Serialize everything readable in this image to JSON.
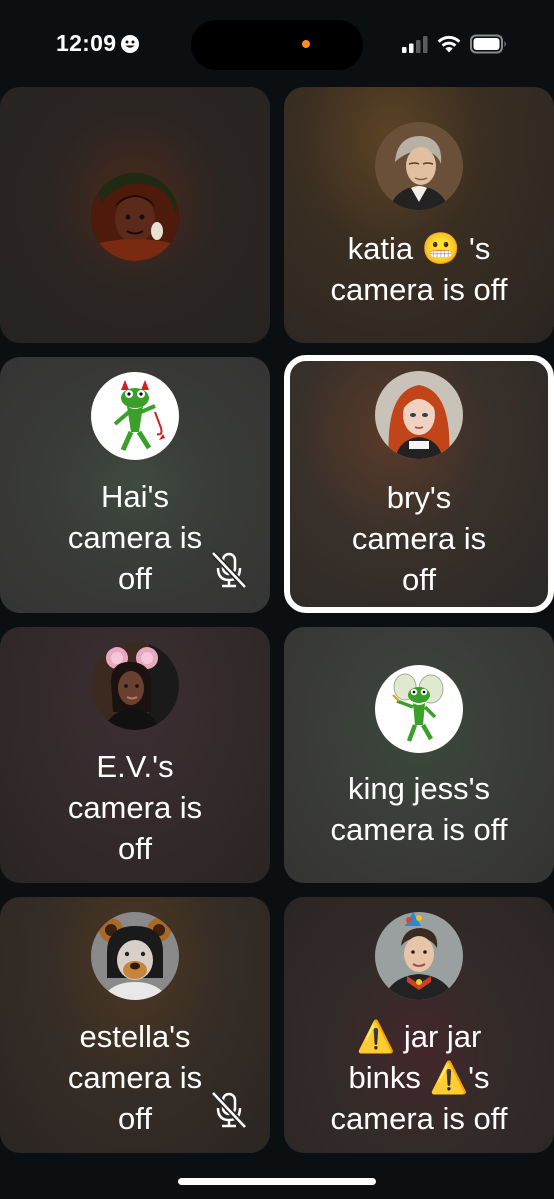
{
  "status_bar": {
    "time": "12:09",
    "focus_icon": "smiley-focus-icon",
    "privacy_dot_color": "#ff8a1f",
    "icons": [
      "cellular-signal-icon",
      "wifi-icon",
      "battery-icon"
    ]
  },
  "tiles": [
    {
      "name": "",
      "lines": [],
      "muted": false,
      "selected": false,
      "avatar": "avatar-dark-cartoon"
    },
    {
      "name": "katia 😬",
      "lines": [
        "katia 😬 's",
        "camera is off"
      ],
      "muted": false,
      "selected": false,
      "avatar": "avatar-portrait-painting"
    },
    {
      "name": "Hai",
      "lines": [
        "Hai's",
        "camera is",
        "off"
      ],
      "muted": true,
      "selected": false,
      "avatar": "avatar-devil-frog"
    },
    {
      "name": "bry",
      "lines": [
        "bry's",
        "camera is",
        "off"
      ],
      "muted": false,
      "selected": true,
      "avatar": "avatar-red-hair"
    },
    {
      "name": "E.V.",
      "lines": [
        "E.V.'s",
        "camera is",
        "off"
      ],
      "muted": false,
      "selected": false,
      "avatar": "avatar-mouse-ears"
    },
    {
      "name": "king jess",
      "lines": [
        "king jess's",
        "camera is off"
      ],
      "muted": false,
      "selected": false,
      "avatar": "avatar-fairy-frog"
    },
    {
      "name": "estella",
      "lines": [
        "estella's",
        "camera is",
        "off"
      ],
      "muted": true,
      "selected": false,
      "avatar": "avatar-bear-filter"
    },
    {
      "name": "⚠️ jar jar binks ⚠️",
      "lines": [
        "⚠️ jar jar",
        "binks ⚠️'s",
        "camera is off"
      ],
      "muted": false,
      "selected": false,
      "avatar": "avatar-party-boy"
    }
  ],
  "colors": {
    "selected_border": "#ffffff",
    "background": "#0b0f12"
  }
}
